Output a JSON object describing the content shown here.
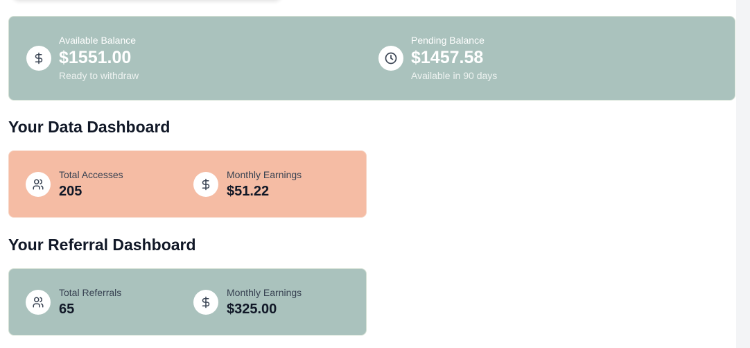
{
  "balances": {
    "available": {
      "label": "Available Balance",
      "amount": "$1551.00",
      "subtitle": "Ready to withdraw",
      "icon": "dollar-icon"
    },
    "pending": {
      "label": "Pending Balance",
      "amount": "$1457.58",
      "subtitle": "Available in 90 days",
      "icon": "clock-icon"
    }
  },
  "data_dashboard": {
    "title": "Your Data Dashboard",
    "stats": [
      {
        "label": "Total Accesses",
        "value": "205",
        "icon": "users-icon"
      },
      {
        "label": "Monthly Earnings",
        "value": "$51.22",
        "icon": "dollar-icon"
      }
    ]
  },
  "referral_dashboard": {
    "title": "Your Referral Dashboard",
    "stats": [
      {
        "label": "Total Referrals",
        "value": "65",
        "icon": "users-icon"
      },
      {
        "label": "Monthly Earnings",
        "value": "$325.00",
        "icon": "dollar-icon"
      }
    ]
  },
  "colors": {
    "balance_card": "#aac2bd",
    "data_card": "#f5bca4",
    "referral_card": "#aac2bd"
  }
}
